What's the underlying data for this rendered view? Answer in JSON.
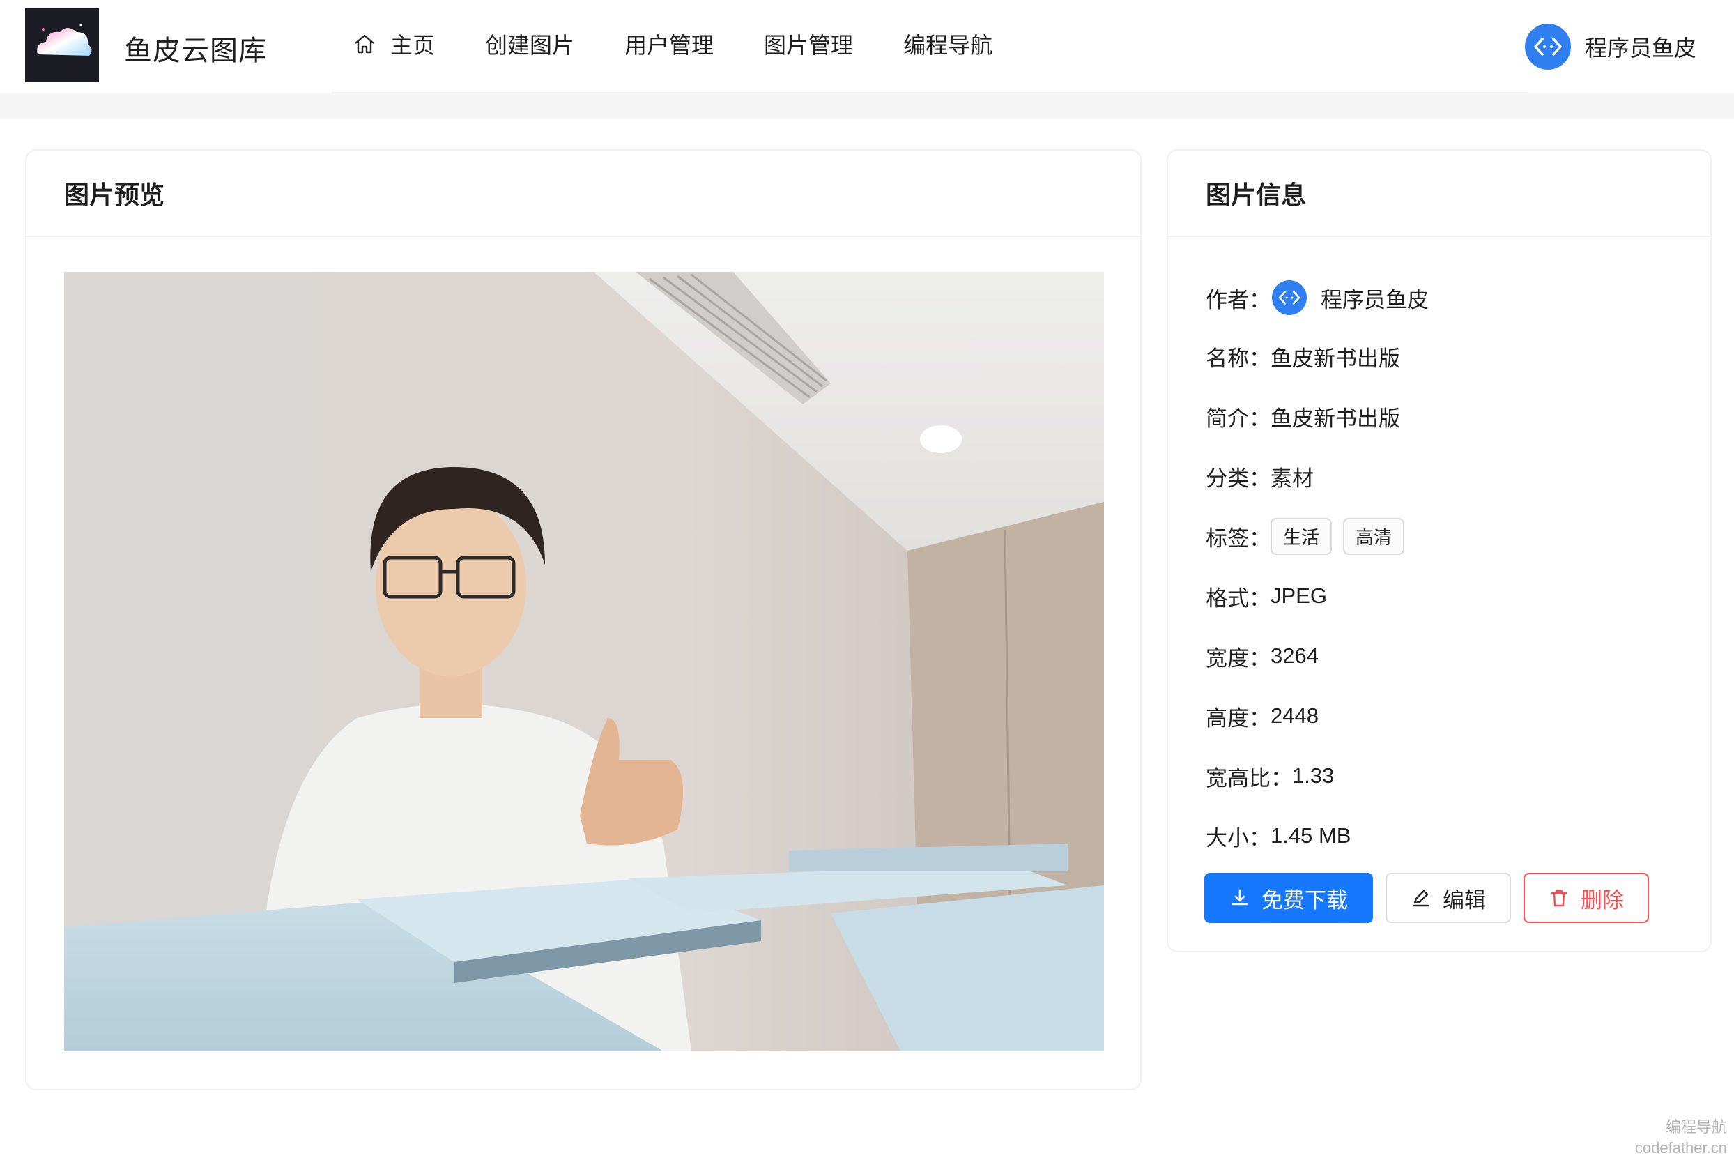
{
  "header": {
    "app_title": "鱼皮云图库",
    "nav": [
      {
        "label": "主页",
        "icon": "home-icon"
      },
      {
        "label": "创建图片"
      },
      {
        "label": "用户管理"
      },
      {
        "label": "图片管理"
      },
      {
        "label": "编程导航"
      }
    ],
    "user_name": "程序员鱼皮"
  },
  "preview": {
    "title": "图片预览"
  },
  "info": {
    "title": "图片信息",
    "author_label": "作者：",
    "author_name": "程序员鱼皮",
    "name_label": "名称：",
    "name_value": "鱼皮新书出版",
    "intro_label": "简介：",
    "intro_value": "鱼皮新书出版",
    "category_label": "分类：",
    "category_value": "素材",
    "tags_label": "标签：",
    "tags": [
      "生活",
      "高清"
    ],
    "format_label": "格式：",
    "format_value": "JPEG",
    "width_label": "宽度：",
    "width_value": "3264",
    "height_label": "高度：",
    "height_value": "2448",
    "ratio_label": "宽高比：",
    "ratio_value": "1.33",
    "size_label": "大小：",
    "size_value": "1.45 MB"
  },
  "actions": {
    "download_label": "免费下载",
    "edit_label": "编辑",
    "delete_label": "删除"
  },
  "watermark": {
    "line1": "编程导航",
    "line2": "codefather.cn"
  },
  "colors": {
    "primary": "#1677ff",
    "danger": "#ff4d4f",
    "avatar": "#2f7ff0"
  }
}
